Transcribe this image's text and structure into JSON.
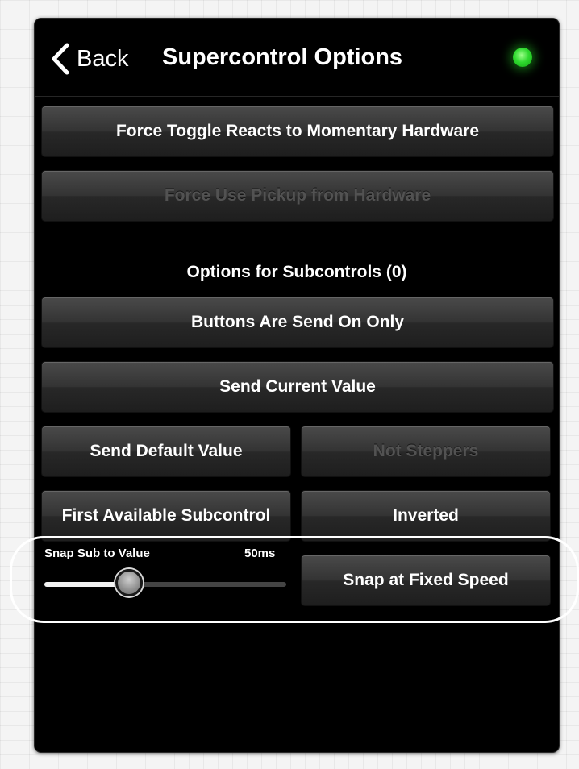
{
  "header": {
    "back_label": "Back",
    "title": "Supercontrol Options",
    "status_color": "#2fd92f"
  },
  "buttons": {
    "force_toggle": "Force Toggle Reacts to Momentary Hardware",
    "force_pickup": "Force Use Pickup from Hardware",
    "buttons_send_on_only": "Buttons Are Send On Only",
    "send_current_value": "Send Current Value",
    "send_default_value": "Send Default Value",
    "not_steppers": "Not Steppers",
    "first_available_subcontrol": "First Available Subcontrol",
    "inverted": "Inverted",
    "snap_fixed_speed": "Snap at Fixed Speed"
  },
  "section": {
    "subcontrols_label": "Options for Subcontrols (0)"
  },
  "slider": {
    "label": "Snap Sub to Value",
    "value_text": "50ms",
    "level": 0.35
  },
  "colors": {
    "background": "#000000",
    "button_text": "#ffffff",
    "disabled_text": "#525252"
  }
}
